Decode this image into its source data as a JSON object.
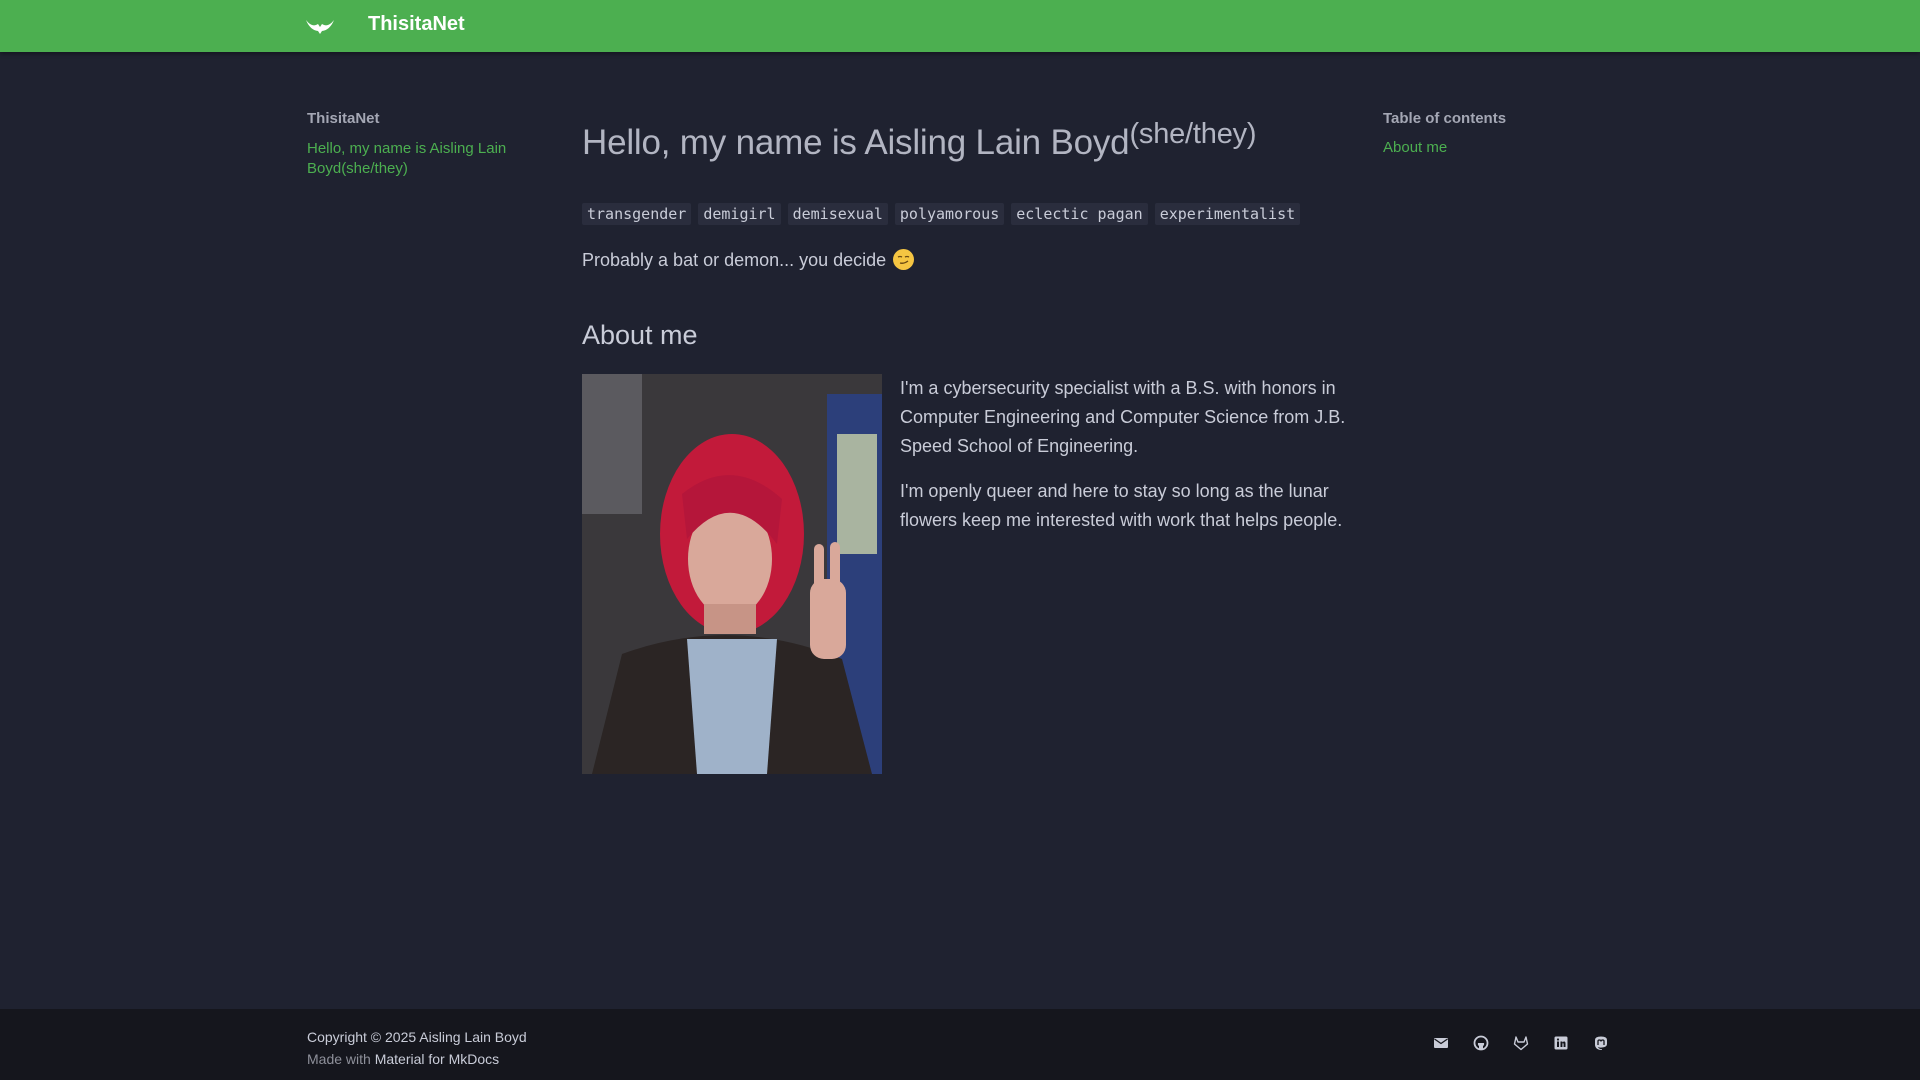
{
  "header": {
    "site_title": "ThisitaNet",
    "logo_icon": "bat-icon",
    "accent": "#4caf50"
  },
  "nav": {
    "title": "ThisitaNet",
    "link": "Hello, my name is Aisling Lain Boyd(she/they)"
  },
  "toc": {
    "title": "Table of contents",
    "items": [
      "About me"
    ]
  },
  "content": {
    "heading": "Hello, my name is Aisling Lain Boyd",
    "pronouns": "(she/they)",
    "tags": [
      "transgender",
      "demigirl",
      "demisexual",
      "polyamorous",
      "eclectic pagan",
      "experimentalist"
    ],
    "tagline": "Probably a bat or demon... you decide",
    "tagline_emoji": "smirking-face-emoji",
    "about_heading": "About me",
    "about_paragraphs": [
      "I'm a cybersecurity specialist with a B.S. with honors in Computer Engineering and Computer Science from J.B. Speed School of Engineering.",
      "I'm openly queer and here to stay so long as the lunar flowers keep me interested with work that helps people."
    ]
  },
  "footer": {
    "copyright": "Copyright © 2025 Aisling Lain Boyd",
    "made_with_prefix": "Made with",
    "made_with_link": "Material for MkDocs",
    "socials": [
      "email-icon",
      "github-icon",
      "gitlab-icon",
      "linkedin-icon",
      "mastodon-icon"
    ]
  },
  "colors": {
    "background": "#1f2230",
    "footer": "#15161d",
    "link": "#4caf50"
  }
}
